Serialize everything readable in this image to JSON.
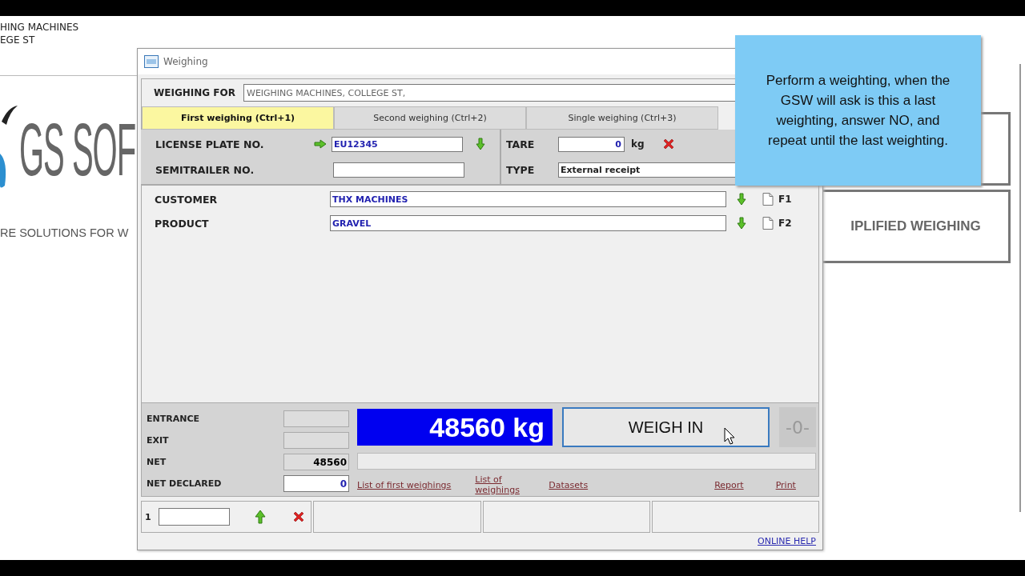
{
  "background_app": {
    "header_lines": [
      "HING MACHINES",
      "EGE ST"
    ],
    "logo_text": "GS SOF",
    "tagline": "RE SOLUTIONS FOR W",
    "buttons": [
      "IPLIFIED WEIGHING"
    ]
  },
  "window": {
    "title": "Weighing"
  },
  "weighing_for": {
    "label": "WEIGHING FOR",
    "value": "WEIGHING MACHINES, COLLEGE ST,"
  },
  "tabs": [
    {
      "label": "First weighing (Ctrl+1)",
      "selected": true
    },
    {
      "label": "Second weighing (Ctrl+2)",
      "selected": false
    },
    {
      "label": "Single weighing (Ctrl+3)",
      "selected": false
    }
  ],
  "vehicle": {
    "license_plate": {
      "label": "LICENSE PLATE NO.",
      "value": "EU12345"
    },
    "semitrailer": {
      "label": "SEMITRAILER NO."
    },
    "tare": {
      "label": "TARE",
      "value": "0",
      "unit": "kg"
    },
    "type": {
      "label": "TYPE",
      "value": "External receipt"
    }
  },
  "details": [
    {
      "label": "CUSTOMER",
      "value": "THX MACHINES",
      "shortcut": "F1"
    },
    {
      "label": "PRODUCT",
      "value": "GRAVEL",
      "shortcut": "F2"
    }
  ],
  "readings": [
    {
      "label": "ENTRANCE",
      "kind": "readonly"
    },
    {
      "label": "EXIT",
      "kind": "readonly"
    },
    {
      "label": "NET",
      "value": "48560",
      "kind": "readonly"
    },
    {
      "label": "NET DECLARED",
      "value": "0",
      "kind": "input"
    }
  ],
  "scale_display": "48560 kg",
  "weigh_button": "WEIGH IN",
  "zero_indicator": "-0-",
  "links": [
    "List of first weighings",
    "List of weighings",
    "Datasets",
    "Report",
    "Print"
  ],
  "footer": {
    "index": "1"
  },
  "online_help": "ONLINE HELP",
  "tooltip": "Perform a weighting, when the GSW will ask is this a last weighting, answer NO, and repeat until the last weighting."
}
